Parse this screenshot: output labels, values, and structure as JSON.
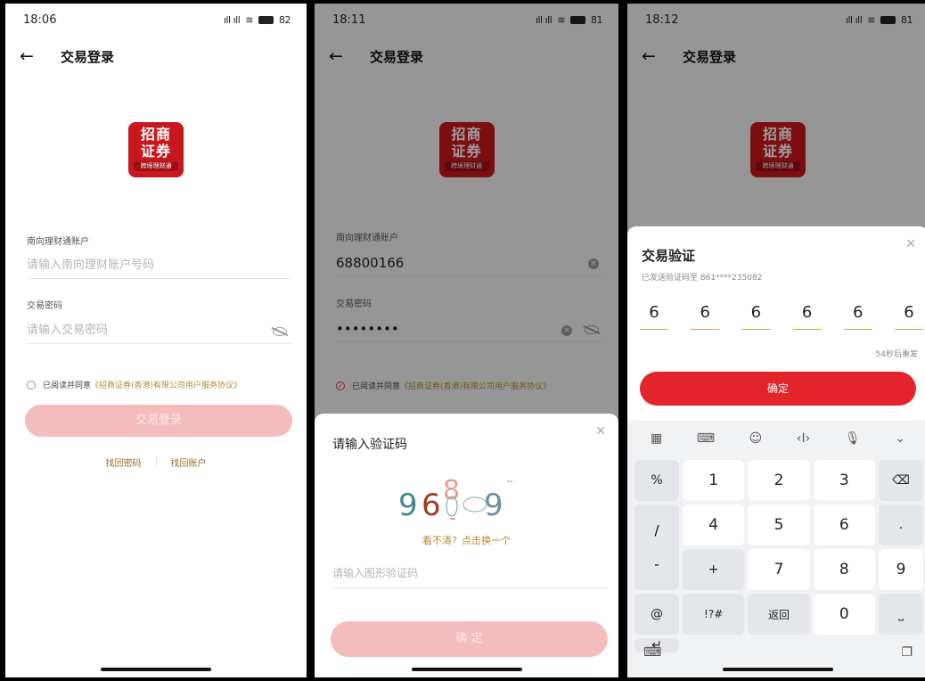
{
  "screen1": {
    "time": "18:06",
    "signal": "⁴ᴳıll ⁴ᴳıll",
    "battery": "82",
    "title": "交易登录",
    "logo": {
      "line1": "招商",
      "line2": "证券",
      "sub": "跨境理财通"
    },
    "account_label": "南向理财通账户",
    "account_placeholder": "请输入南向理财账户号码",
    "password_label": "交易密码",
    "password_placeholder": "请输入交易密码",
    "agree_text": "已阅读并同意",
    "agree_link": "《招商证券(香港)有限公司用户服务协议》",
    "login_button": "交易登录",
    "forgot_password": "找回密码",
    "forgot_account": "找回账户"
  },
  "screen2": {
    "time": "18:11",
    "battery": "81",
    "title": "交易登录",
    "account_label": "南向理财通账户",
    "account_value": "68800166",
    "password_label": "交易密码",
    "password_value": "••••••••",
    "agree_text": "已阅读并同意",
    "agree_link": "《招商证券(香港)有限公司用户服务协议》",
    "sheet_title": "请输入验证码",
    "captcha_digits": [
      "9",
      "6",
      "8",
      "9"
    ],
    "refresh_text": "看不清？点击换一个",
    "captcha_placeholder": "请输入图形验证码",
    "confirm_button": "确 定"
  },
  "screen3": {
    "time": "18:12",
    "battery": "81",
    "title": "交易登录",
    "sheet_title": "交易验证",
    "sent_to": "已发送验证码至 861****235082",
    "code": [
      "6",
      "6",
      "6",
      "6",
      "6",
      "6"
    ],
    "resend": "54秒后重发",
    "confirm_button": "确定",
    "keyboard": {
      "row1": [
        "%",
        "1",
        "2",
        "3"
      ],
      "row2": [
        "/",
        "-",
        "4",
        "5",
        "6",
        "."
      ],
      "row3": [
        "+",
        "7",
        "8",
        "9",
        "@"
      ],
      "row4": [
        "!?#",
        "返回",
        "0"
      ]
    }
  },
  "colors": {
    "brand_red": "#c8171e",
    "button_red": "#e3242b",
    "link_gold": "#b58a3b"
  }
}
